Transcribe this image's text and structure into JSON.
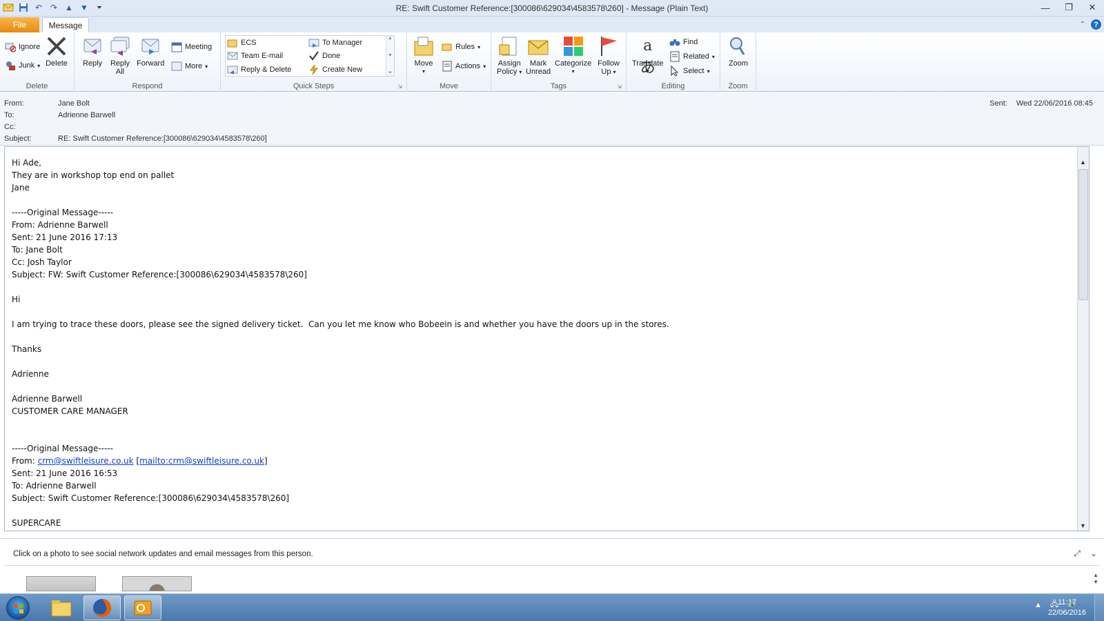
{
  "window": {
    "title": "RE: Swift Customer Reference:[300086\\629034\\4583578\\260]  -  Message (Plain Text)"
  },
  "tabs": {
    "file": "File",
    "message": "Message"
  },
  "ribbon": {
    "delete_group": {
      "label": "Delete",
      "ignore": "Ignore",
      "junk": "Junk",
      "delete": "Delete"
    },
    "respond_group": {
      "label": "Respond",
      "reply": "Reply",
      "reply_all_1": "Reply",
      "reply_all_2": "All",
      "forward": "Forward",
      "meeting": "Meeting",
      "more": "More"
    },
    "quicksteps_group": {
      "label": "Quick Steps",
      "ecs": "ECS",
      "team_email": "Team E-mail",
      "reply_delete": "Reply & Delete",
      "to_manager": "To Manager",
      "done": "Done",
      "create_new": "Create New"
    },
    "move_group": {
      "label": "Move",
      "move": "Move",
      "rules": "Rules",
      "actions": "Actions"
    },
    "tags_group": {
      "label": "Tags",
      "assign_policy_1": "Assign",
      "assign_policy_2": "Policy",
      "mark_unread_1": "Mark",
      "mark_unread_2": "Unread",
      "categorize": "Categorize",
      "follow_up_1": "Follow",
      "follow_up_2": "Up"
    },
    "editing_group": {
      "label": "Editing",
      "translate": "Translate",
      "find": "Find",
      "related": "Related",
      "select": "Select"
    },
    "zoom_group": {
      "label": "Zoom",
      "zoom": "Zoom"
    }
  },
  "header": {
    "from_label": "From:",
    "from_value": "Jane Bolt",
    "to_label": "To:",
    "to_value": "Adrienne Barwell",
    "cc_label": "Cc:",
    "cc_value": "",
    "subject_label": "Subject:",
    "subject_value": "RE: Swift Customer Reference:[300086\\629034\\4583578\\260]",
    "sent_label": "Sent:",
    "sent_value": "Wed 22/06/2016 08:45"
  },
  "body": {
    "l1": "Hi Ade,",
    "l2": "They are in workshop top end on pallet",
    "l3": "Jane",
    "l4": "",
    "l5": "-----Original Message-----",
    "l6": "From: Adrienne Barwell",
    "l7": "Sent: 21 June 2016 17:13",
    "l8": "To: Jane Bolt",
    "l9": "Cc: Josh Taylor",
    "l10": "Subject: FW: Swift Customer Reference:[300086\\629034\\4583578\\260]",
    "l11": "",
    "l12": "Hi",
    "l13": "",
    "l14": "I am trying to trace these doors, please see the signed delivery ticket.  Can you let me know who Bobeein is and whether you have the doors up in the stores.",
    "l15": "",
    "l16": "Thanks",
    "l17": "",
    "l18": "Adrienne",
    "l19": "",
    "l20": "Adrienne Barwell",
    "l21": "CUSTOMER CARE MANAGER",
    "l22": "",
    "l23": "",
    "l24": "-----Original Message-----",
    "l25_prefix": "From: ",
    "l25_link1": "crm@swiftleisure.co.uk",
    "l25_mid": " [",
    "l25_link2": "mailto:crm@swiftleisure.co.uk",
    "l25_suffix": "]",
    "l26": "Sent: 21 June 2016 16:53",
    "l27": "To: Adrienne Barwell",
    "l28": "Subject: Swift Customer Reference:[300086\\629034\\4583578\\260]",
    "l29": "",
    "l30": "SUPERCARE"
  },
  "people_pane": {
    "message": "Click on a photo to see social network updates and email messages from this person."
  },
  "taskbar": {
    "time": "11:17",
    "date": "22/06/2016"
  },
  "colors": {
    "file_tab": "#e88a0f",
    "link": "#0b3fd0",
    "taskbar": "#4a78aa"
  }
}
